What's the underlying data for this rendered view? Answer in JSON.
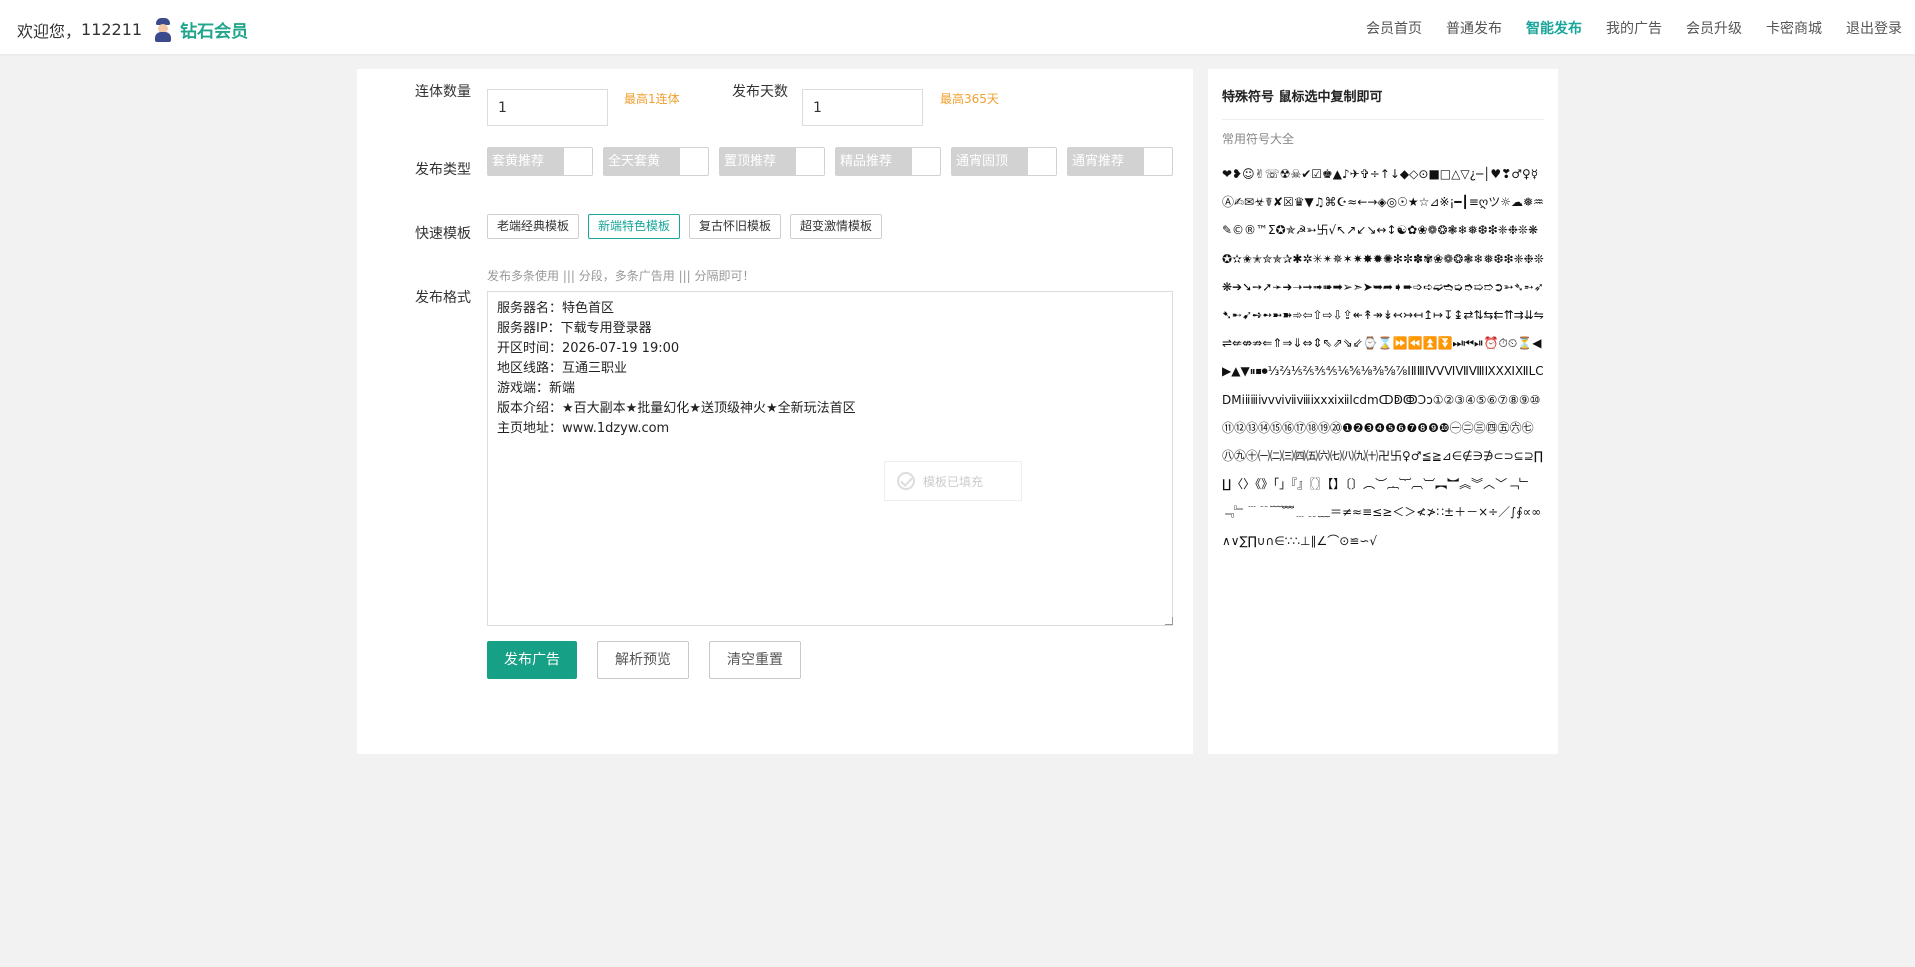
{
  "header": {
    "welcome_prefix": "欢迎您，",
    "username": "112211",
    "member_level": "钻石会员",
    "nav": [
      {
        "label": "会员首页",
        "active": false
      },
      {
        "label": "普通发布",
        "active": false
      },
      {
        "label": "智能发布",
        "active": true
      },
      {
        "label": "我的广告",
        "active": false
      },
      {
        "label": "会员升级",
        "active": false
      },
      {
        "label": "卡密商城",
        "active": false
      },
      {
        "label": "退出登录",
        "active": false
      }
    ]
  },
  "form": {
    "conjoined_label": "连体数量",
    "conjoined_value": "1",
    "conjoined_hint": "最高1连体",
    "days_label": "发布天数",
    "days_value": "1",
    "days_hint": "最高365天",
    "type_label": "发布类型",
    "types": [
      {
        "label": "套黄推荐"
      },
      {
        "label": "全天套黄"
      },
      {
        "label": "置顶推荐"
      },
      {
        "label": "精品推荐"
      },
      {
        "label": "通宵固顶"
      },
      {
        "label": "通宵推荐"
      }
    ],
    "template_label": "快速模板",
    "templates": [
      {
        "label": "老端经典模板",
        "active": false
      },
      {
        "label": "新端特色模板",
        "active": true
      },
      {
        "label": "复古怀旧模板",
        "active": false
      },
      {
        "label": "超变激情模板",
        "active": false
      }
    ],
    "format_label": "发布格式",
    "format_hint": "发布多条使用 ||| 分段，多条广告用 ||| 分隔即可！",
    "content": "服务器名：特色首区\n服务器IP：下载专用登录器\n开区时间：2026-07-19 19:00\n地区线路：互通三职业\n游戏端：新端\n版本介绍：★百大副本★批量幻化★送顶级神火★全新玩法首区\n主页地址：www.1dzyw.com",
    "toast": "模板已填充",
    "buttons": {
      "publish": "发布广告",
      "preview": "解析预览",
      "reset": "清空重置"
    }
  },
  "side": {
    "title": "特殊符号 鼠标选中复制即可",
    "subtitle": "常用符号大全",
    "symbols": "❤❥☺✌☏☢☠✔☑♚▲♪✈✞÷↑↓◆◇⊙■□△▽¿─│♥❣♂♀☿Ⓐ✍✉☣☤✘☒♛▼♫⌘☪≈←→◈◎☉★☆⊿※¡━┃≡ღツ☼☁❅♒✎©®™Σ✪✯☭➳卐√↖↗↙↘↔↕☯✿❀❁❂❃❄❅❆❇❈❉❊❋✪✫✬✭✮✯✰✱✲✳✴✵✶✷✸✹✺✻✼✽✾❀❁❂❃❄❅❆❇❈❉❊❋➔➘➙➚➛➜➝➞➟➠➡➢➣➤➥➦➧➨➩➪➫➬➭➮➯➱➲➳➴➵➶➷➸➹➺➻➼➽➾⇦⇧⇨⇩⇪↞↟↠↡↢↣↤↥↦↧↨⇄⇅⇆⇇⇈⇉⇊⇋⇌⇍⇎⇏⇐⇑⇒⇓⇔⇕⇖⇗⇘⇙⌚⌛⏩⏪⏫⏬⏭⏮⏯⏰⏱⏲⏳◀▶▲▼⏸⏹⏺⅓⅔⅕⅖⅗⅘⅙⅚⅛⅜⅝⅞ⅠⅡⅢⅣⅤⅥⅦⅧⅨⅩⅪⅫⅬⅭⅮⅯⅰⅱⅲⅳⅴⅵⅶⅷⅸⅹⅺⅻⅼⅽⅾⅿↀↁↂↃↄ①②③④⑤⑥⑦⑧⑨⑩⑪⑫⑬⑭⑮⑯⑰⑱⑲⑳❶❷❸❹❺❻❼❽❾❿㊀㊁㊂㊃㊄㊅㊆㊇㊈㊉㈠㈡㈢㈣㈤㈥㈦㈧㈨㈩卍卐♀♂≦≧⊿∈∉∋∌⊂⊃⊆⊇∏∐〈〉《》「」『』〖〗【】〔〕︵︶︷︸︹︺︻︼︽︾︿﹀﹁﹂﹃﹄﹉﹊﹋﹌﹍﹎﹏＝≠≈≡≤≥＜＞≮≯∷±＋－×÷／∫∮∝∞∧∨∑∏∪∩∈∵∴⊥∥∠⌒⊙≌∽√"
  }
}
